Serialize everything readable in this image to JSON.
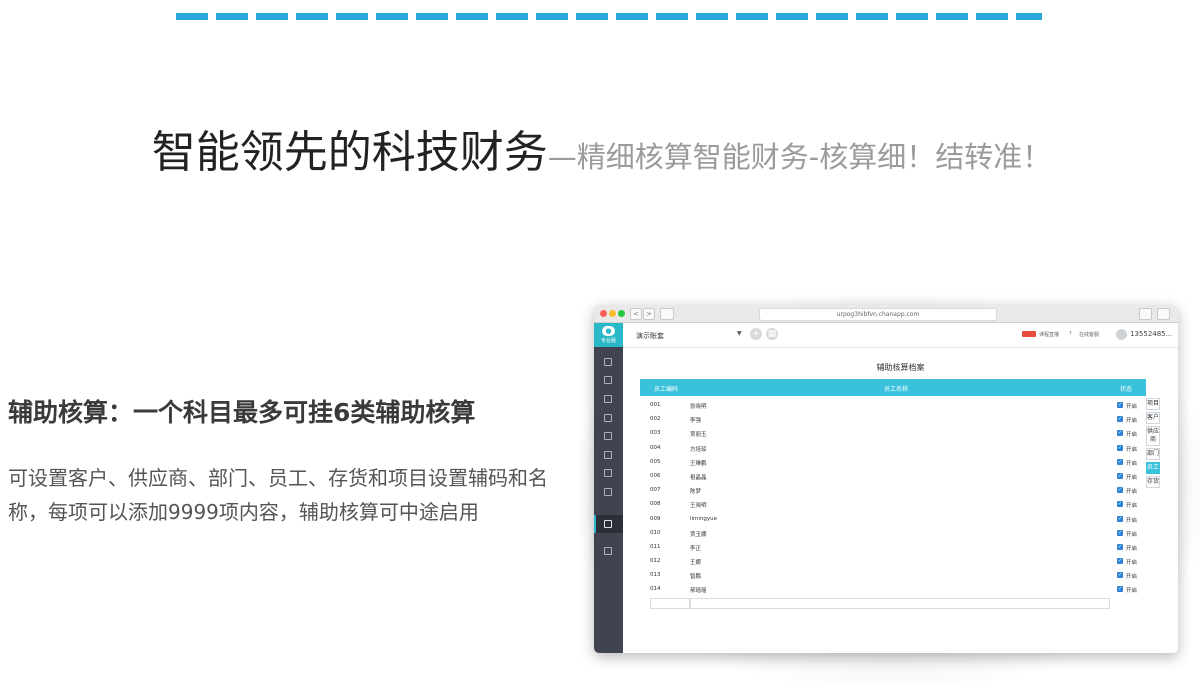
{
  "headline": {
    "main": "智能领先的科技财务",
    "sub": "—精细核算智能财务-核算细！结转准！"
  },
  "feature": {
    "title": "辅助核算：一个科目最多可挂6类辅助核算",
    "description": "可设置客户、供应商、部门、员工、存货和项目设置辅码和名称，每项可以添加9999项内容，辅助核算可中途启用"
  },
  "browser": {
    "url": "urpog3hibfvn.chanapp.com",
    "nav_back": "<",
    "nav_forward": ">"
  },
  "app": {
    "logo_label": "专业版",
    "account_name": "演示账套",
    "top_links": {
      "course": "课程直播",
      "help": "在线客服"
    },
    "user_phone": "13552485...",
    "content_title": "辅助核算档案",
    "table": {
      "headers": {
        "code": "员工编码",
        "name": "员工名称",
        "status": "状态"
      },
      "rows": [
        {
          "code": "001",
          "name": "张晓明",
          "status": "开启"
        },
        {
          "code": "002",
          "name": "李强",
          "status": "开启"
        },
        {
          "code": "003",
          "name": "贾丽玉",
          "status": "开启"
        },
        {
          "code": "004",
          "name": "方培琼",
          "status": "开启"
        },
        {
          "code": "005",
          "name": "王琳鹏",
          "status": "开启"
        },
        {
          "code": "006",
          "name": "祖晶晶",
          "status": "开启"
        },
        {
          "code": "007",
          "name": "陈梦",
          "status": "开启"
        },
        {
          "code": "008",
          "name": "王晓明",
          "status": "开启"
        },
        {
          "code": "009",
          "name": "limingyue",
          "status": "开启"
        },
        {
          "code": "010",
          "name": "贾玉娜",
          "status": "开启"
        },
        {
          "code": "011",
          "name": "李正",
          "status": "开启"
        },
        {
          "code": "012",
          "name": "王娜",
          "status": "开启"
        },
        {
          "code": "013",
          "name": "智鹏",
          "status": "开启"
        },
        {
          "code": "014",
          "name": "郝瑶瑶",
          "status": "开启"
        }
      ]
    },
    "side_tabs": [
      {
        "label": "项目",
        "active": false
      },
      {
        "label": "客户",
        "active": false
      },
      {
        "label": "供应商",
        "active": false
      },
      {
        "label": "部门",
        "active": false
      },
      {
        "label": "员工",
        "active": true
      },
      {
        "label": "存货",
        "active": false
      }
    ]
  },
  "colors": {
    "accent": "#2aa7da",
    "table_header": "#3ac1dc",
    "sidebar": "#3f4450"
  }
}
